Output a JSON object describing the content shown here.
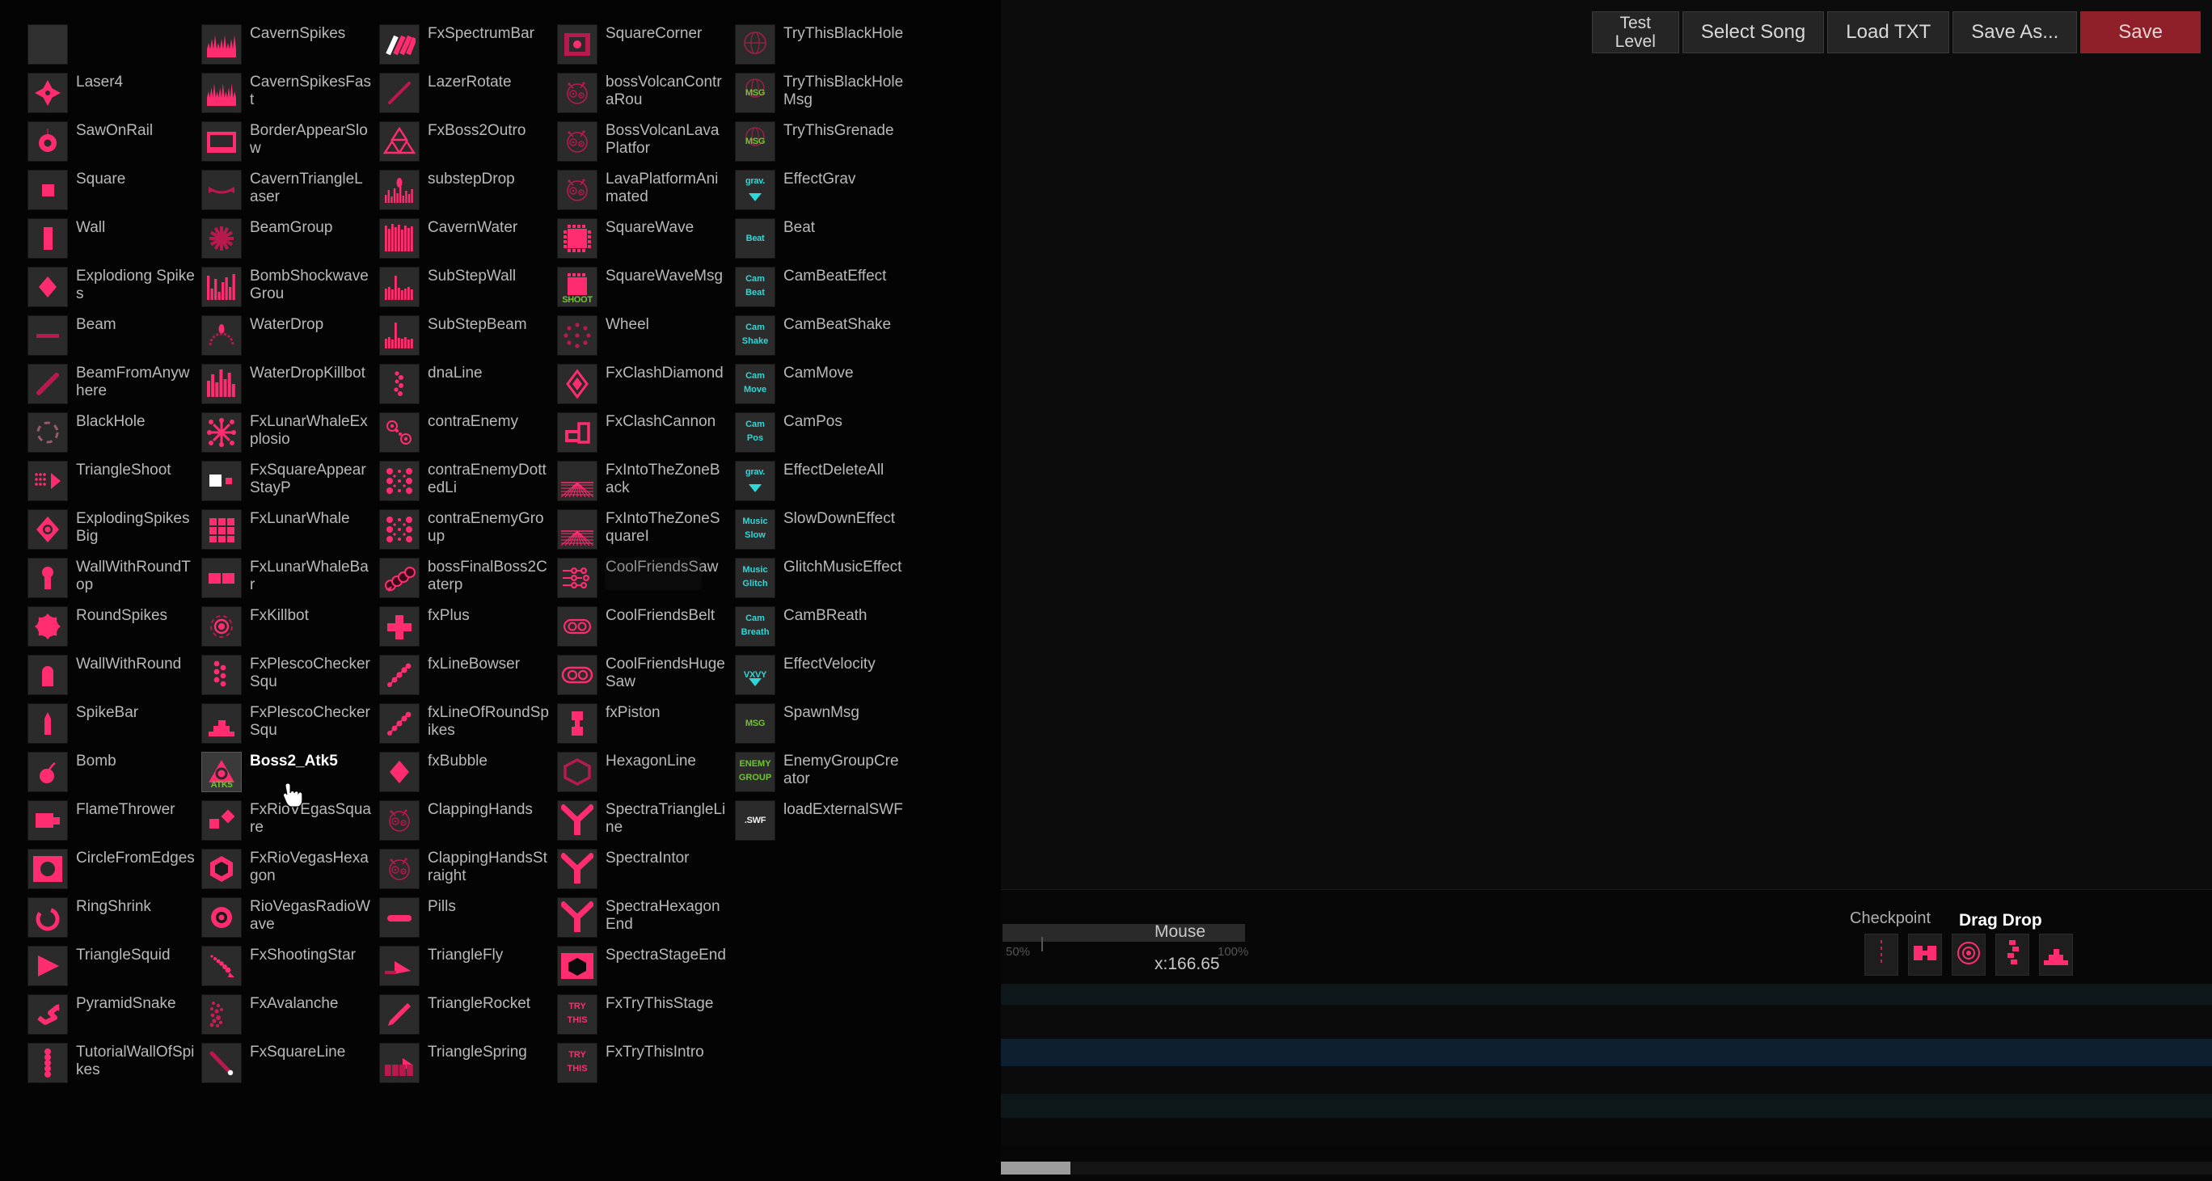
{
  "toolbar": {
    "buttons": [
      {
        "label": "Test\nLevel",
        "name": "test-level-button",
        "style": "two-line"
      },
      {
        "label": "Select Song",
        "name": "select-song-button",
        "style": "normal"
      },
      {
        "label": "Load TXT",
        "name": "load-txt-button",
        "style": "normal"
      },
      {
        "label": "Save As...",
        "name": "save-as-button",
        "style": "normal"
      },
      {
        "label": "Save",
        "name": "save-button",
        "style": "save"
      }
    ],
    "accent_save_color": "#8f2029"
  },
  "palette": {
    "selected_item": "Boss2_Atk5",
    "accent_color": "#ff2d6f",
    "columns": [
      {
        "name": "column-1",
        "items": [
          {
            "label": "",
            "icon": "empty-thumb"
          },
          {
            "label": "Laser4",
            "icon": "laser4-icon"
          },
          {
            "label": "SawOnRail",
            "icon": "saw-on-rail-icon"
          },
          {
            "label": "Square",
            "icon": "square-icon"
          },
          {
            "label": "Wall",
            "icon": "wall-icon"
          },
          {
            "label": "Explodiong Spikes",
            "icon": "exploding-spikes-icon"
          },
          {
            "label": "Beam",
            "icon": "beam-icon"
          },
          {
            "label": "BeamFromAnywhere",
            "icon": "beam-from-anywhere-icon"
          },
          {
            "label": "BlackHole",
            "icon": "black-hole-icon"
          },
          {
            "label": "TriangleShoot",
            "icon": "triangle-shoot-icon"
          },
          {
            "label": "ExplodingSpikesBig",
            "icon": "exploding-spikes-big-icon"
          },
          {
            "label": "WallWithRoundTop",
            "icon": "wall-with-round-top-icon"
          },
          {
            "label": "RoundSpikes",
            "icon": "round-spikes-icon"
          },
          {
            "label": "WallWithRound",
            "icon": "wall-with-round-icon"
          },
          {
            "label": "SpikeBar",
            "icon": "spike-bar-icon"
          },
          {
            "label": "Bomb",
            "icon": "bomb-icon"
          },
          {
            "label": "FlameThrower",
            "icon": "flame-thrower-icon"
          },
          {
            "label": "CircleFromEdges",
            "icon": "circle-from-edges-icon"
          },
          {
            "label": "RingShrink",
            "icon": "ring-shrink-icon"
          },
          {
            "label": "TriangleSquid",
            "icon": "triangle-squid-icon"
          },
          {
            "label": "PyramidSnake",
            "icon": "pyramid-snake-icon"
          },
          {
            "label": "TutorialWallOfSpikes",
            "icon": "tutorial-wall-of-spikes-icon"
          }
        ]
      },
      {
        "name": "column-2",
        "items": [
          {
            "label": "CavernSpikes",
            "icon": "cavern-spikes-icon"
          },
          {
            "label": "CavernSpikesFast",
            "icon": "cavern-spikes-fast-icon"
          },
          {
            "label": "BorderAppearSlow",
            "icon": "border-appear-slow-icon"
          },
          {
            "label": "CavernTriangleLaser",
            "icon": "cavern-triangle-laser-icon"
          },
          {
            "label": "BeamGroup",
            "icon": "beam-group-icon"
          },
          {
            "label": "BombShockwaveGrou",
            "icon": "bomb-shockwave-group-icon"
          },
          {
            "label": "WaterDrop",
            "icon": "water-drop-icon"
          },
          {
            "label": "WaterDropKillbot",
            "icon": "water-drop-killbot-icon"
          },
          {
            "label": "FxLunarWhaleExplosio",
            "icon": "fx-lunar-whale-explosion-icon"
          },
          {
            "label": "FxSquareAppearStayP",
            "icon": "fx-square-appear-stay-icon"
          },
          {
            "label": "FxLunarWhale",
            "icon": "fx-lunar-whale-icon"
          },
          {
            "label": "FxLunarWhaleBar",
            "icon": "fx-lunar-whale-bar-icon"
          },
          {
            "label": "FxKillbot",
            "icon": "fx-killbot-icon"
          },
          {
            "label": "FxPlescoCheckerSqu",
            "icon": "fx-plesco-checker-squ-icon"
          },
          {
            "label": "FxPlescoCheckerSqu",
            "icon": "fx-plesco-checker-squ2-icon"
          },
          {
            "label": "Boss2_Atk5",
            "icon": "boss2-atk5-icon",
            "selected": true
          },
          {
            "label": "FxRioVEgasSquare",
            "icon": "fx-rio-vegas-square-icon"
          },
          {
            "label": "FxRioVegasHexagon",
            "icon": "fx-rio-vegas-hexagon-icon"
          },
          {
            "label": "RioVegasRadioWave",
            "icon": "rio-vegas-radio-wave-icon"
          },
          {
            "label": "FxShootingStar",
            "icon": "fx-shooting-star-icon"
          },
          {
            "label": "FxAvalanche",
            "icon": "fx-avalanche-icon"
          },
          {
            "label": "FxSquareLine",
            "icon": "fx-square-line-icon"
          }
        ]
      },
      {
        "name": "column-3",
        "items": [
          {
            "label": "FxSpectrumBar",
            "icon": "fx-spectrum-bar-icon"
          },
          {
            "label": "LazerRotate",
            "icon": "lazer-rotate-icon"
          },
          {
            "label": "FxBoss2Outro",
            "icon": "fx-boss2-outro-icon"
          },
          {
            "label": "substepDrop",
            "icon": "substep-drop-icon"
          },
          {
            "label": "CavernWater",
            "icon": "cavern-water-icon"
          },
          {
            "label": "SubStepWall",
            "icon": "substep-wall-icon"
          },
          {
            "label": "SubStepBeam",
            "icon": "substep-beam-icon"
          },
          {
            "label": "dnaLine",
            "icon": "dna-line-icon"
          },
          {
            "label": "contraEnemy",
            "icon": "contra-enemy-icon"
          },
          {
            "label": "contraEnemyDottedLi",
            "icon": "contra-enemy-dotted-line-icon"
          },
          {
            "label": "contraEnemyGroup",
            "icon": "contra-enemy-group-icon"
          },
          {
            "label": "bossFinalBoss2Caterp",
            "icon": "boss-final-boss2-caterp-icon"
          },
          {
            "label": "fxPlus",
            "icon": "fx-plus-icon"
          },
          {
            "label": "fxLineBowser",
            "icon": "fx-line-bowser-icon"
          },
          {
            "label": "fxLineOfRoundSpikes",
            "icon": "fx-line-of-round-spikes-icon"
          },
          {
            "label": "fxBubble",
            "icon": "fx-bubble-icon"
          },
          {
            "label": "ClappingHands",
            "icon": "clapping-hands-icon"
          },
          {
            "label": "ClappingHandsStraight",
            "icon": "clapping-hands-straight-icon"
          },
          {
            "label": "Pills",
            "icon": "pills-icon"
          },
          {
            "label": "TriangleFly",
            "icon": "triangle-fly-icon"
          },
          {
            "label": "TriangleRocket",
            "icon": "triangle-rocket-icon"
          },
          {
            "label": "TriangleSpring",
            "icon": "triangle-spring-icon"
          }
        ]
      },
      {
        "name": "column-4",
        "items": [
          {
            "label": "SquareCorner",
            "icon": "square-corner-icon"
          },
          {
            "label": "bossVolcanContraRou",
            "icon": "boss-volcan-contra-rou-icon"
          },
          {
            "label": "BossVolcanLavaPlatfor",
            "icon": "boss-volcan-lava-platfor-icon"
          },
          {
            "label": "LavaPlatformAnimated",
            "icon": "lava-platform-animated-icon"
          },
          {
            "label": "SquareWave",
            "icon": "square-wave-icon"
          },
          {
            "label": "SquareWaveMsg",
            "icon": "square-wave-msg-icon",
            "tag": "SHOOT"
          },
          {
            "label": "Wheel",
            "icon": "wheel-icon"
          },
          {
            "label": "FxClashDiamond",
            "icon": "fx-clash-diamond-icon"
          },
          {
            "label": "FxClashCannon",
            "icon": "fx-clash-cannon-icon"
          },
          {
            "label": "FxIntoTheZoneBack",
            "icon": "fx-into-the-zone-back-icon"
          },
          {
            "label": "FxIntoTheZoneSquareI",
            "icon": "fx-into-the-zone-square-icon"
          },
          {
            "label": "CoolFriendsSaw",
            "icon": "cool-friends-saw-icon"
          },
          {
            "label": "CoolFriendsBelt",
            "icon": "cool-friends-belt-icon"
          },
          {
            "label": "CoolFriendsHugeSaw",
            "icon": "cool-friends-huge-saw-icon"
          },
          {
            "label": "fxPiston",
            "icon": "fx-piston-icon"
          },
          {
            "label": "HexagonLine",
            "icon": "hexagon-line-icon"
          },
          {
            "label": "SpectraTriangleLine",
            "icon": "spectra-triangle-line-icon"
          },
          {
            "label": "SpectraIntor",
            "icon": "spectra-intor-icon"
          },
          {
            "label": "SpectraHexagonEnd",
            "icon": "spectra-hexagon-end-icon"
          },
          {
            "label": "SpectraStageEnd",
            "icon": "spectra-stage-end-icon"
          },
          {
            "label": "FxTryThisStage",
            "icon": "fx-try-this-stage-icon",
            "tag": "TRY THIS"
          },
          {
            "label": "FxTryThisIntro",
            "icon": "fx-try-this-intro-icon",
            "tag": "TRY THIS"
          }
        ]
      },
      {
        "name": "column-5",
        "items": [
          {
            "label": "TryThisBlackHole",
            "icon": "try-this-black-hole-icon"
          },
          {
            "label": "TryThisBlackHoleMsg",
            "icon": "try-this-black-hole-msg-icon",
            "tag": "MSG"
          },
          {
            "label": "TryThisGrenade",
            "icon": "try-this-grenade-icon",
            "tag": "MSG"
          },
          {
            "label": "EffectGrav",
            "icon": "effect-grav-icon",
            "tag": "grav."
          },
          {
            "label": "Beat",
            "icon": "beat-icon",
            "tag": "Beat"
          },
          {
            "label": "CamBeatEffect",
            "icon": "cam-beat-effect-icon",
            "tag": "Cam Beat"
          },
          {
            "label": "CamBeatShake",
            "icon": "cam-beat-shake-icon",
            "tag": "Cam Shake"
          },
          {
            "label": "CamMove",
            "icon": "cam-move-icon",
            "tag": "Cam Move"
          },
          {
            "label": "CamPos",
            "icon": "cam-pos-icon",
            "tag": "Cam Pos"
          },
          {
            "label": "EffectDeleteAll",
            "icon": "effect-delete-all-icon",
            "tag": "grav."
          },
          {
            "label": "SlowDownEffect",
            "icon": "slow-down-effect-icon",
            "tag": "Music Slow"
          },
          {
            "label": "GlitchMusicEffect",
            "icon": "glitch-music-effect-icon",
            "tag": "Music Glitch"
          },
          {
            "label": "CamBReath",
            "icon": "cam-breath-icon",
            "tag": "Cam Breath"
          },
          {
            "label": "EffectVelocity",
            "icon": "effect-velocity-icon",
            "tag": "VXVY"
          },
          {
            "label": "SpawnMsg",
            "icon": "spawn-msg-icon",
            "tag": "MSG"
          },
          {
            "label": "EnemyGroupCreator",
            "icon": "enemy-group-creator-icon",
            "tag": "ENEMY GROUP"
          },
          {
            "label": "loadExternalSWF",
            "icon": "load-external-swf-icon",
            "tag": ".SWF"
          }
        ]
      }
    ]
  },
  "bottom": {
    "zoom_min_label": "50%",
    "zoom_max_label": "100%",
    "mouse_title": "Mouse",
    "mouse_coords": "x:166.65",
    "checkpoint_label": "Checkpoint",
    "dragdrop_label": "Drag Drop",
    "tools": [
      {
        "name": "checkpoint-tool",
        "icon": "checkpoint-line-icon"
      },
      {
        "name": "drag-drop-wall-tool",
        "icon": "wall-block-icon"
      },
      {
        "name": "drag-drop-ring-tool",
        "icon": "ring-icon"
      },
      {
        "name": "drag-drop-spikes-tool",
        "icon": "dotted-spikes-icon"
      },
      {
        "name": "drag-drop-stairs-tool",
        "icon": "stairs-icon"
      }
    ]
  }
}
